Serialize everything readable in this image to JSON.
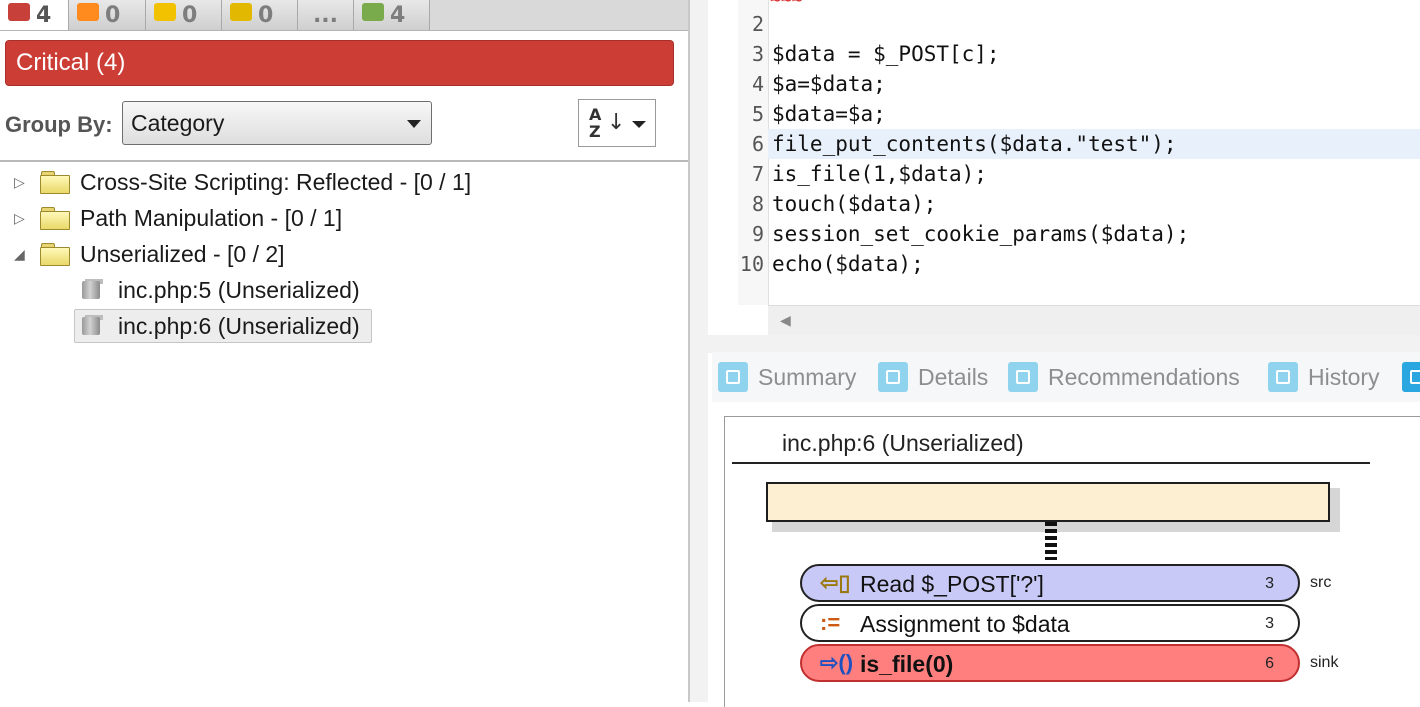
{
  "severity_tabs": [
    {
      "color": "#c8403a",
      "count": "4",
      "active": true
    },
    {
      "color": "#ff8a1e",
      "count": "0",
      "active": false
    },
    {
      "color": "#f2c200",
      "count": "0",
      "active": false
    },
    {
      "color": "#e3b800",
      "count": "0",
      "active": false
    },
    {
      "color": "",
      "count": "...",
      "active": false
    },
    {
      "color": "#79aa4c",
      "count": "4",
      "active": false
    }
  ],
  "filter_header": "Critical (4)",
  "group_by": {
    "label": "Group By:",
    "value": "Category"
  },
  "sort_button": {
    "icon": "sort-az-icon",
    "letters": "A↓Z"
  },
  "tree": [
    {
      "label": "Cross-Site Scripting: Reflected - [0 / 1]",
      "expanded": false,
      "type": "folder"
    },
    {
      "label": "Path Manipulation - [0 / 1]",
      "expanded": false,
      "type": "folder"
    },
    {
      "label": "Unserialized - [0 / 2]",
      "expanded": true,
      "type": "folder"
    },
    {
      "label": "inc.php:5 (Unserialized)",
      "type": "issue"
    },
    {
      "label": "inc.php:6 (Unserialized)",
      "type": "issue",
      "selected": true
    }
  ],
  "code": {
    "lines": [
      {
        "n": "2",
        "text": ""
      },
      {
        "n": "3",
        "text": "$data = $_POST[c];"
      },
      {
        "n": "4",
        "text": "$a=$data;"
      },
      {
        "n": "5",
        "text": "$data=$a;"
      },
      {
        "n": "6",
        "text": "file_put_contents($data.\"test\");",
        "highlight": true
      },
      {
        "n": "7",
        "text": "is_file(1,$data);"
      },
      {
        "n": "8",
        "text": "touch($data);"
      },
      {
        "n": "9",
        "text": "session_set_cookie_params($data);"
      },
      {
        "n": "10",
        "text": "echo($data);"
      }
    ]
  },
  "detail_tabs": [
    "Summary",
    "Details",
    "Recommendations",
    "History"
  ],
  "diagram": {
    "title": "inc.php:6 (Unserialized)",
    "nodes": [
      {
        "icon": "⇦▯",
        "label": "Read $_POST['?']",
        "num": "3",
        "tag": "src",
        "color": "#c9c9f7"
      },
      {
        "icon": ":=",
        "label": "Assignment to $data",
        "num": "3",
        "tag": "",
        "color": "#ffffff"
      },
      {
        "icon": "⇨()",
        "label": "is_file(0)",
        "num": "6",
        "tag": "sink",
        "color": "#ff7f7f"
      }
    ]
  }
}
